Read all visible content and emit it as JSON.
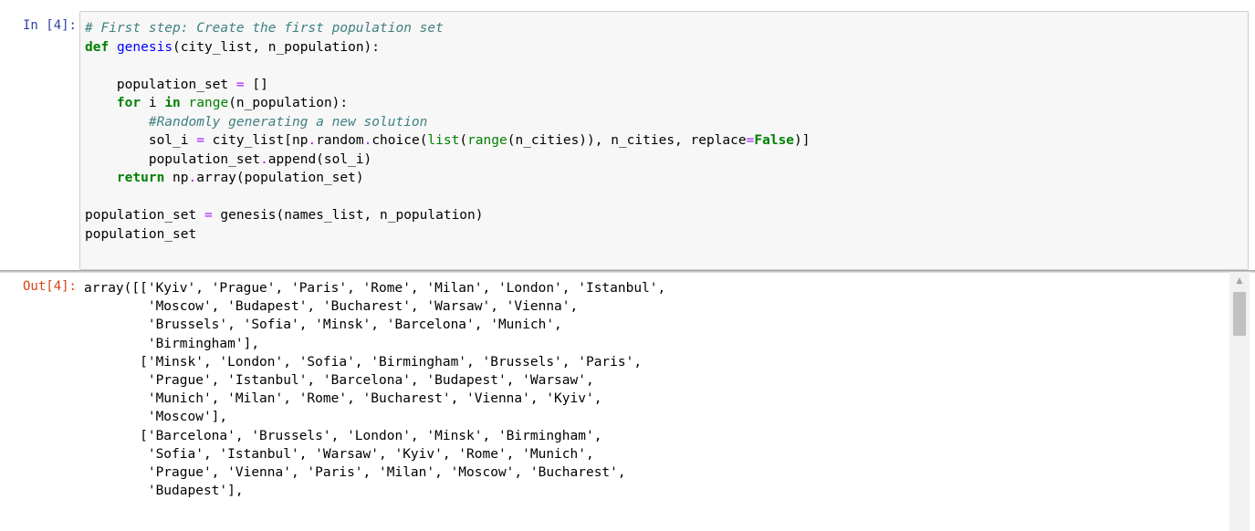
{
  "cell": {
    "in_prompt": "In [4]:",
    "out_prompt": "Out[4]:",
    "code_lines": [
      [
        {
          "t": "# First step: Create the first population set",
          "c": "cm"
        }
      ],
      [
        {
          "t": "def",
          "c": "kw"
        },
        {
          "t": " "
        },
        {
          "t": "genesis",
          "c": "fn"
        },
        {
          "t": "(city_list, n_population):"
        }
      ],
      [],
      [
        {
          "t": "    population_set "
        },
        {
          "t": "=",
          "c": "op"
        },
        {
          "t": " []"
        }
      ],
      [
        {
          "t": "    "
        },
        {
          "t": "for",
          "c": "kw"
        },
        {
          "t": " i "
        },
        {
          "t": "in",
          "c": "kw"
        },
        {
          "t": " "
        },
        {
          "t": "range",
          "c": "bi"
        },
        {
          "t": "(n_population):"
        }
      ],
      [
        {
          "t": "        "
        },
        {
          "t": "#Randomly generating a new solution",
          "c": "cm"
        }
      ],
      [
        {
          "t": "        sol_i "
        },
        {
          "t": "=",
          "c": "op"
        },
        {
          "t": " city_list[np"
        },
        {
          "t": ".",
          "c": "op"
        },
        {
          "t": "random"
        },
        {
          "t": ".",
          "c": "op"
        },
        {
          "t": "choice("
        },
        {
          "t": "list",
          "c": "bi"
        },
        {
          "t": "("
        },
        {
          "t": "range",
          "c": "bi"
        },
        {
          "t": "(n_cities)), n_cities, replace"
        },
        {
          "t": "=",
          "c": "op"
        },
        {
          "t": "False",
          "c": "kw"
        },
        {
          "t": ")]"
        }
      ],
      [
        {
          "t": "        population_set"
        },
        {
          "t": ".",
          "c": "op"
        },
        {
          "t": "append(sol_i)"
        }
      ],
      [
        {
          "t": "    "
        },
        {
          "t": "return",
          "c": "kw"
        },
        {
          "t": " np"
        },
        {
          "t": ".",
          "c": "op"
        },
        {
          "t": "array(population_set)"
        }
      ],
      [],
      [
        {
          "t": "population_set "
        },
        {
          "t": "=",
          "c": "op"
        },
        {
          "t": " genesis(names_list, n_population)"
        }
      ],
      [
        {
          "t": "population_set"
        }
      ]
    ],
    "output_lines": [
      "array([['Kyiv', 'Prague', 'Paris', 'Rome', 'Milan', 'London', 'Istanbul',",
      "        'Moscow', 'Budapest', 'Bucharest', 'Warsaw', 'Vienna',",
      "        'Brussels', 'Sofia', 'Minsk', 'Barcelona', 'Munich',",
      "        'Birmingham'],",
      "       ['Minsk', 'London', 'Sofia', 'Birmingham', 'Brussels', 'Paris',",
      "        'Prague', 'Istanbul', 'Barcelona', 'Budapest', 'Warsaw',",
      "        'Munich', 'Milan', 'Rome', 'Bucharest', 'Vienna', 'Kyiv',",
      "        'Moscow'],",
      "       ['Barcelona', 'Brussels', 'London', 'Minsk', 'Birmingham',",
      "        'Sofia', 'Istanbul', 'Warsaw', 'Kyiv', 'Rome', 'Munich',",
      "        'Prague', 'Vienna', 'Paris', 'Milan', 'Moscow', 'Bucharest',",
      "        'Budapest'],"
    ]
  },
  "scrollbar": {
    "up_arrow_icon": "scroll-up-arrow-icon"
  }
}
